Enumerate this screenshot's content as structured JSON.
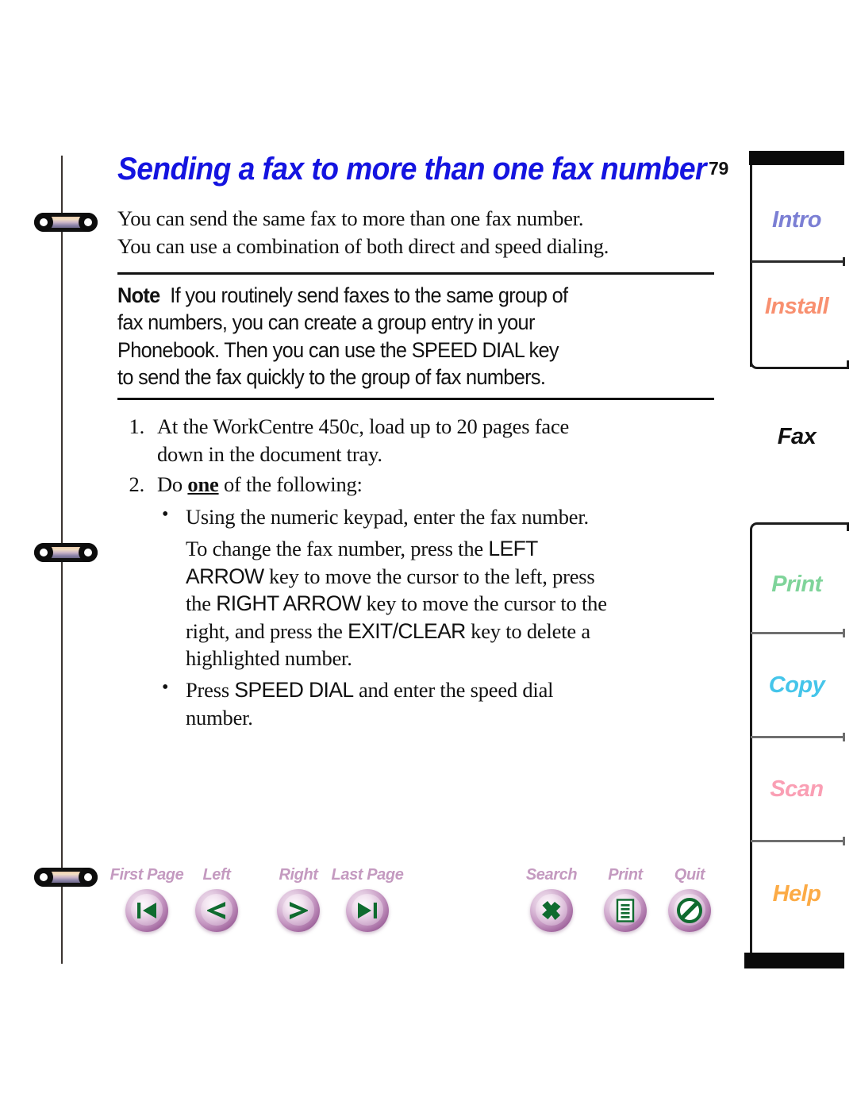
{
  "page": {
    "number": "79"
  },
  "heading": "Sending a fax to more than one fax number",
  "intro": {
    "line1": "You can send the same fax to more than one fax number.",
    "line2": "You can use a combination of both direct and speed dialing."
  },
  "note": {
    "label": "Note",
    "line1": "If you routinely send faxes to the same group of",
    "line2": "fax numbers, you can create a group entry in your",
    "line3_a": "Phonebook. Then you can use the ",
    "line3_key": "SPEED DIAL",
    "line3_b": " key",
    "line4": "to send the fax quickly to the group of fax numbers."
  },
  "steps": [
    {
      "num": "1.",
      "line1": "At the WorkCentre 450c, load up to 20 pages face",
      "line2": "down in the document tray."
    },
    {
      "num": "2.",
      "pre": "Do ",
      "emphasis": "one",
      "post": " of the following:"
    }
  ],
  "bullets": {
    "first": "Using the numeric keypad, enter the fax number.",
    "detail": {
      "l1_a": "To change the fax number, press the ",
      "l1_key": "LEFT",
      "l2_key": "ARROW",
      "l2_b": " key to move the cursor to the left, press",
      "l3_a": "the ",
      "l3_key": "RIGHT ARROW",
      "l3_b": " key to move the cursor to the",
      "l4_a": "right, and press the ",
      "l4_key": "EXIT/CLEAR",
      "l4_b": " key to delete a",
      "l5": "highlighted number."
    },
    "second": {
      "pre": "Press ",
      "key": "SPEED DIAL",
      "post": " and enter the speed dial",
      "line2": "number."
    }
  },
  "navbar": {
    "buttons": [
      {
        "id": "first-page",
        "label": "First Page",
        "icon": "first-page-icon"
      },
      {
        "id": "left",
        "label": "Left",
        "icon": "left-arrow-icon"
      },
      {
        "id": "right",
        "label": "Right",
        "icon": "right-arrow-icon"
      },
      {
        "id": "last-page",
        "label": "Last Page",
        "icon": "last-page-icon"
      },
      {
        "id": "search",
        "label": "Search",
        "icon": "search-icon"
      },
      {
        "id": "print",
        "label": "Print",
        "icon": "print-icon"
      },
      {
        "id": "quit",
        "label": "Quit",
        "icon": "quit-icon"
      }
    ],
    "label_color": "#c49ac0",
    "glyph_color": "#0f6b2f"
  },
  "tabs": [
    {
      "id": "intro",
      "label": "Intro",
      "color": "#7b7fd4",
      "active": false
    },
    {
      "id": "install",
      "label": "Install",
      "color": "#f89070",
      "active": false
    },
    {
      "id": "fax",
      "label": "Fax",
      "color": "#111111",
      "active": true
    },
    {
      "id": "print",
      "label": "Print",
      "color": "#7fd49a",
      "active": false
    },
    {
      "id": "copy",
      "label": "Copy",
      "color": "#45c5ea",
      "active": false
    },
    {
      "id": "scan",
      "label": "Scan",
      "color": "#fa9fb4",
      "active": false
    },
    {
      "id": "help",
      "label": "Help",
      "color": "#fcab46",
      "active": false
    }
  ]
}
